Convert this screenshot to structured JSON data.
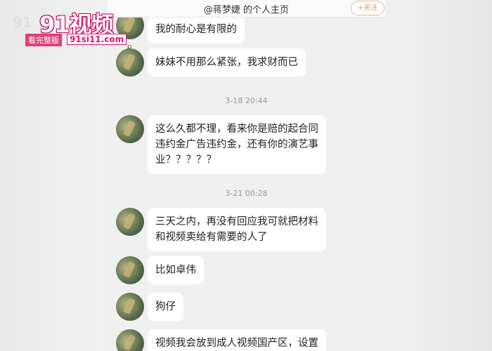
{
  "watermark": {
    "brand": "91视频",
    "ghost": "91",
    "badge": "看完整版",
    "domain": "91si11.com"
  },
  "header": {
    "title": "@蒋梦婕 的个人主页",
    "follow_label": "+关注"
  },
  "messages": [
    {
      "text": "我的耐心是有限的"
    },
    {
      "text": "妹妹不用那么紧张，我求财而已"
    },
    {
      "line1": "这么久都不理，看来你是赔的起合同",
      "line2": "违约金广告违约金，还有你的演艺事",
      "line3": "业？？？？？"
    },
    {
      "line1": "三天之内，再没有回应我可就把材料",
      "line2": "和视频卖给有需要的人了"
    },
    {
      "text": "比如卓伟"
    },
    {
      "text": "狗仔"
    },
    {
      "text": "视频我会放到成人视频国产区，设置"
    }
  ],
  "timestamps": [
    "3-18 20:44",
    "3-21 00:28"
  ]
}
